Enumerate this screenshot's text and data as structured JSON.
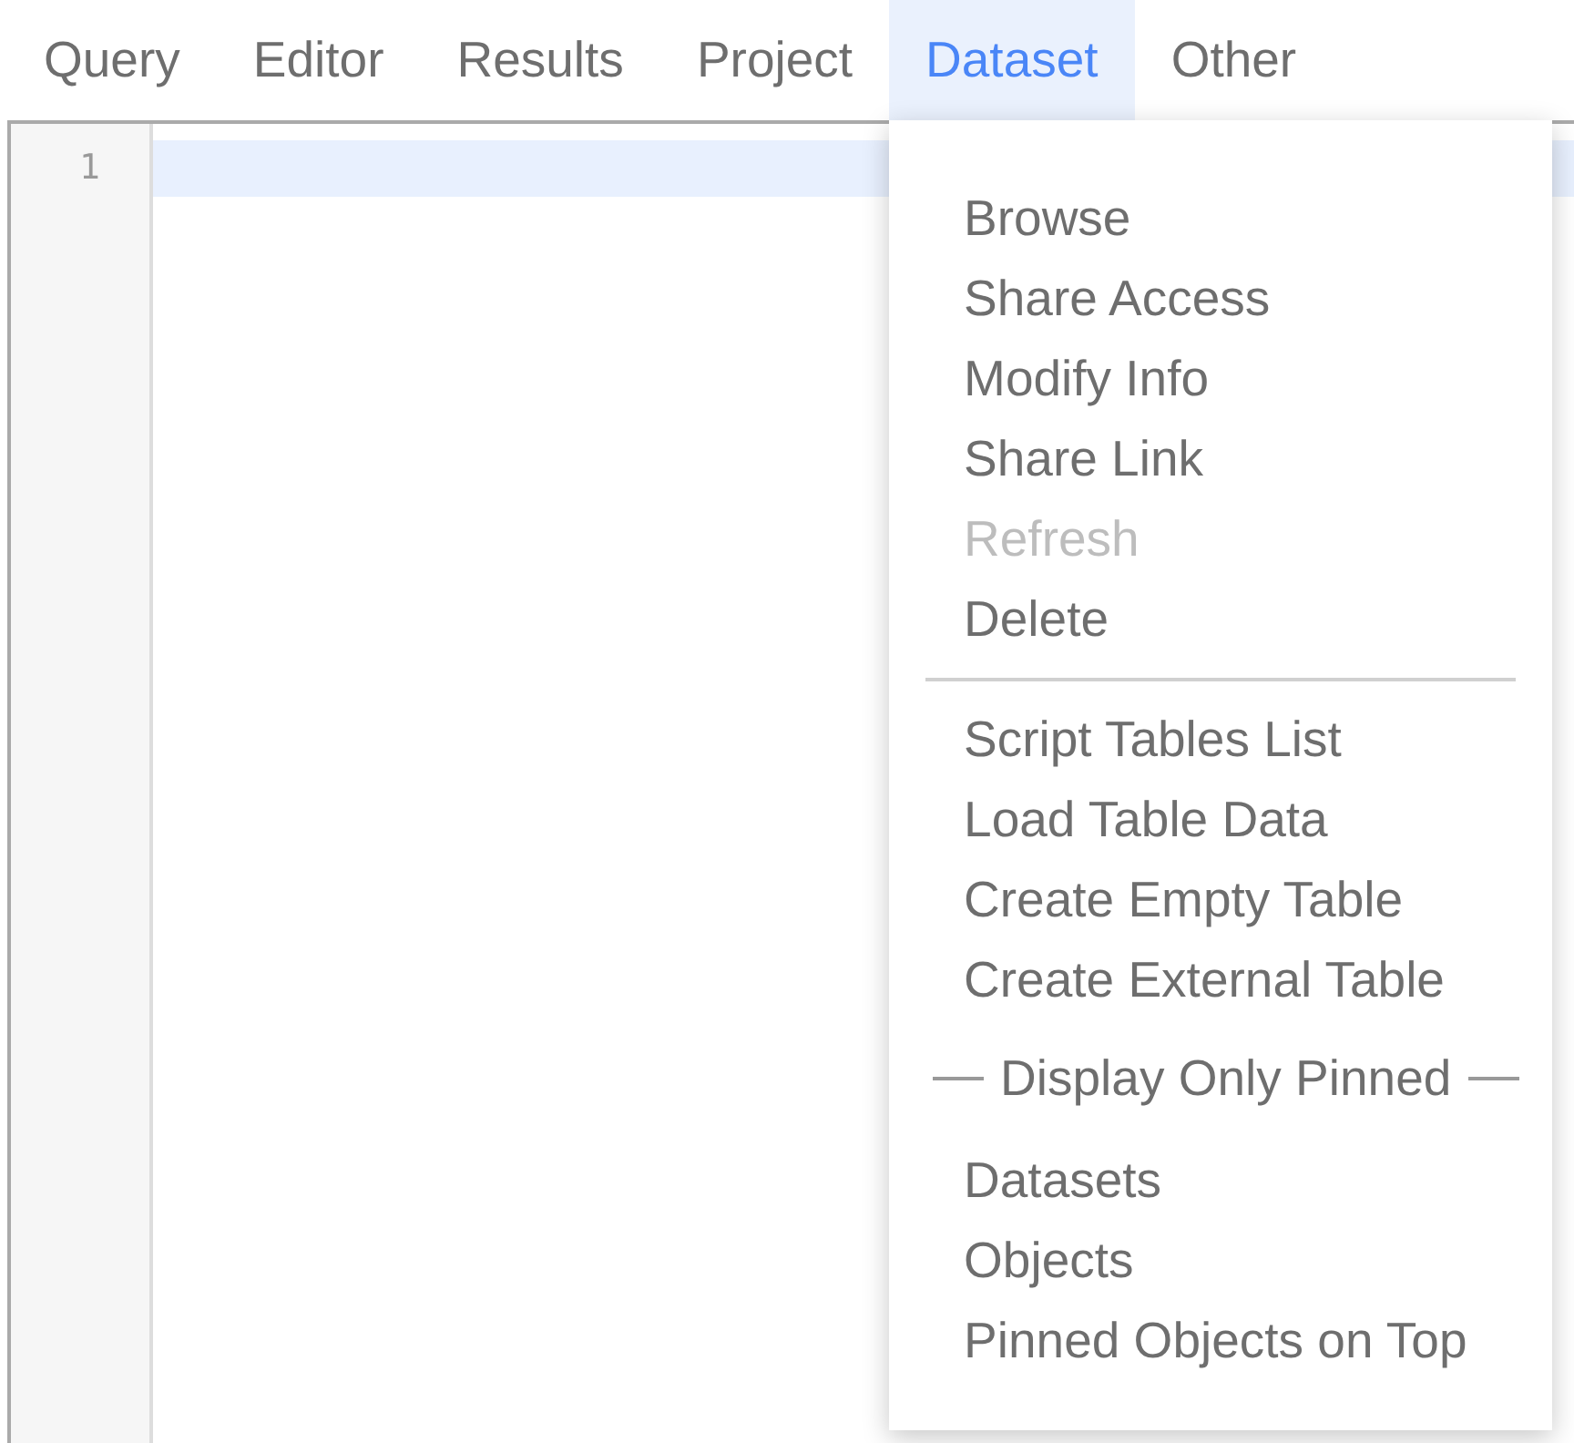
{
  "menu_bar": {
    "tabs": [
      {
        "label": "Query",
        "selected": false
      },
      {
        "label": "Editor",
        "selected": false
      },
      {
        "label": "Results",
        "selected": false
      },
      {
        "label": "Project",
        "selected": false
      },
      {
        "label": "Dataset",
        "selected": true
      },
      {
        "label": "Other",
        "selected": false
      }
    ]
  },
  "editor": {
    "lines": [
      {
        "number": "1",
        "current": true
      }
    ]
  },
  "dropdown": {
    "items": [
      {
        "kind": "item",
        "label": "Browse",
        "disabled": false
      },
      {
        "kind": "item",
        "label": "Share Access",
        "disabled": false
      },
      {
        "kind": "item",
        "label": "Modify Info",
        "disabled": false
      },
      {
        "kind": "item",
        "label": "Share Link",
        "disabled": false
      },
      {
        "kind": "item",
        "label": "Refresh",
        "disabled": true
      },
      {
        "kind": "item",
        "label": "Delete",
        "disabled": false
      },
      {
        "kind": "separator"
      },
      {
        "kind": "item",
        "label": "Script Tables List",
        "disabled": false
      },
      {
        "kind": "item",
        "label": "Load Table Data",
        "disabled": false
      },
      {
        "kind": "item",
        "label": "Create Empty Table",
        "disabled": false
      },
      {
        "kind": "item",
        "label": "Create External Table",
        "disabled": false
      },
      {
        "kind": "heading",
        "label": "Display Only Pinned"
      },
      {
        "kind": "item",
        "label": "Datasets",
        "disabled": false
      },
      {
        "kind": "item",
        "label": "Objects",
        "disabled": false
      },
      {
        "kind": "item",
        "label": "Pinned Objects on Top",
        "disabled": false
      }
    ]
  }
}
